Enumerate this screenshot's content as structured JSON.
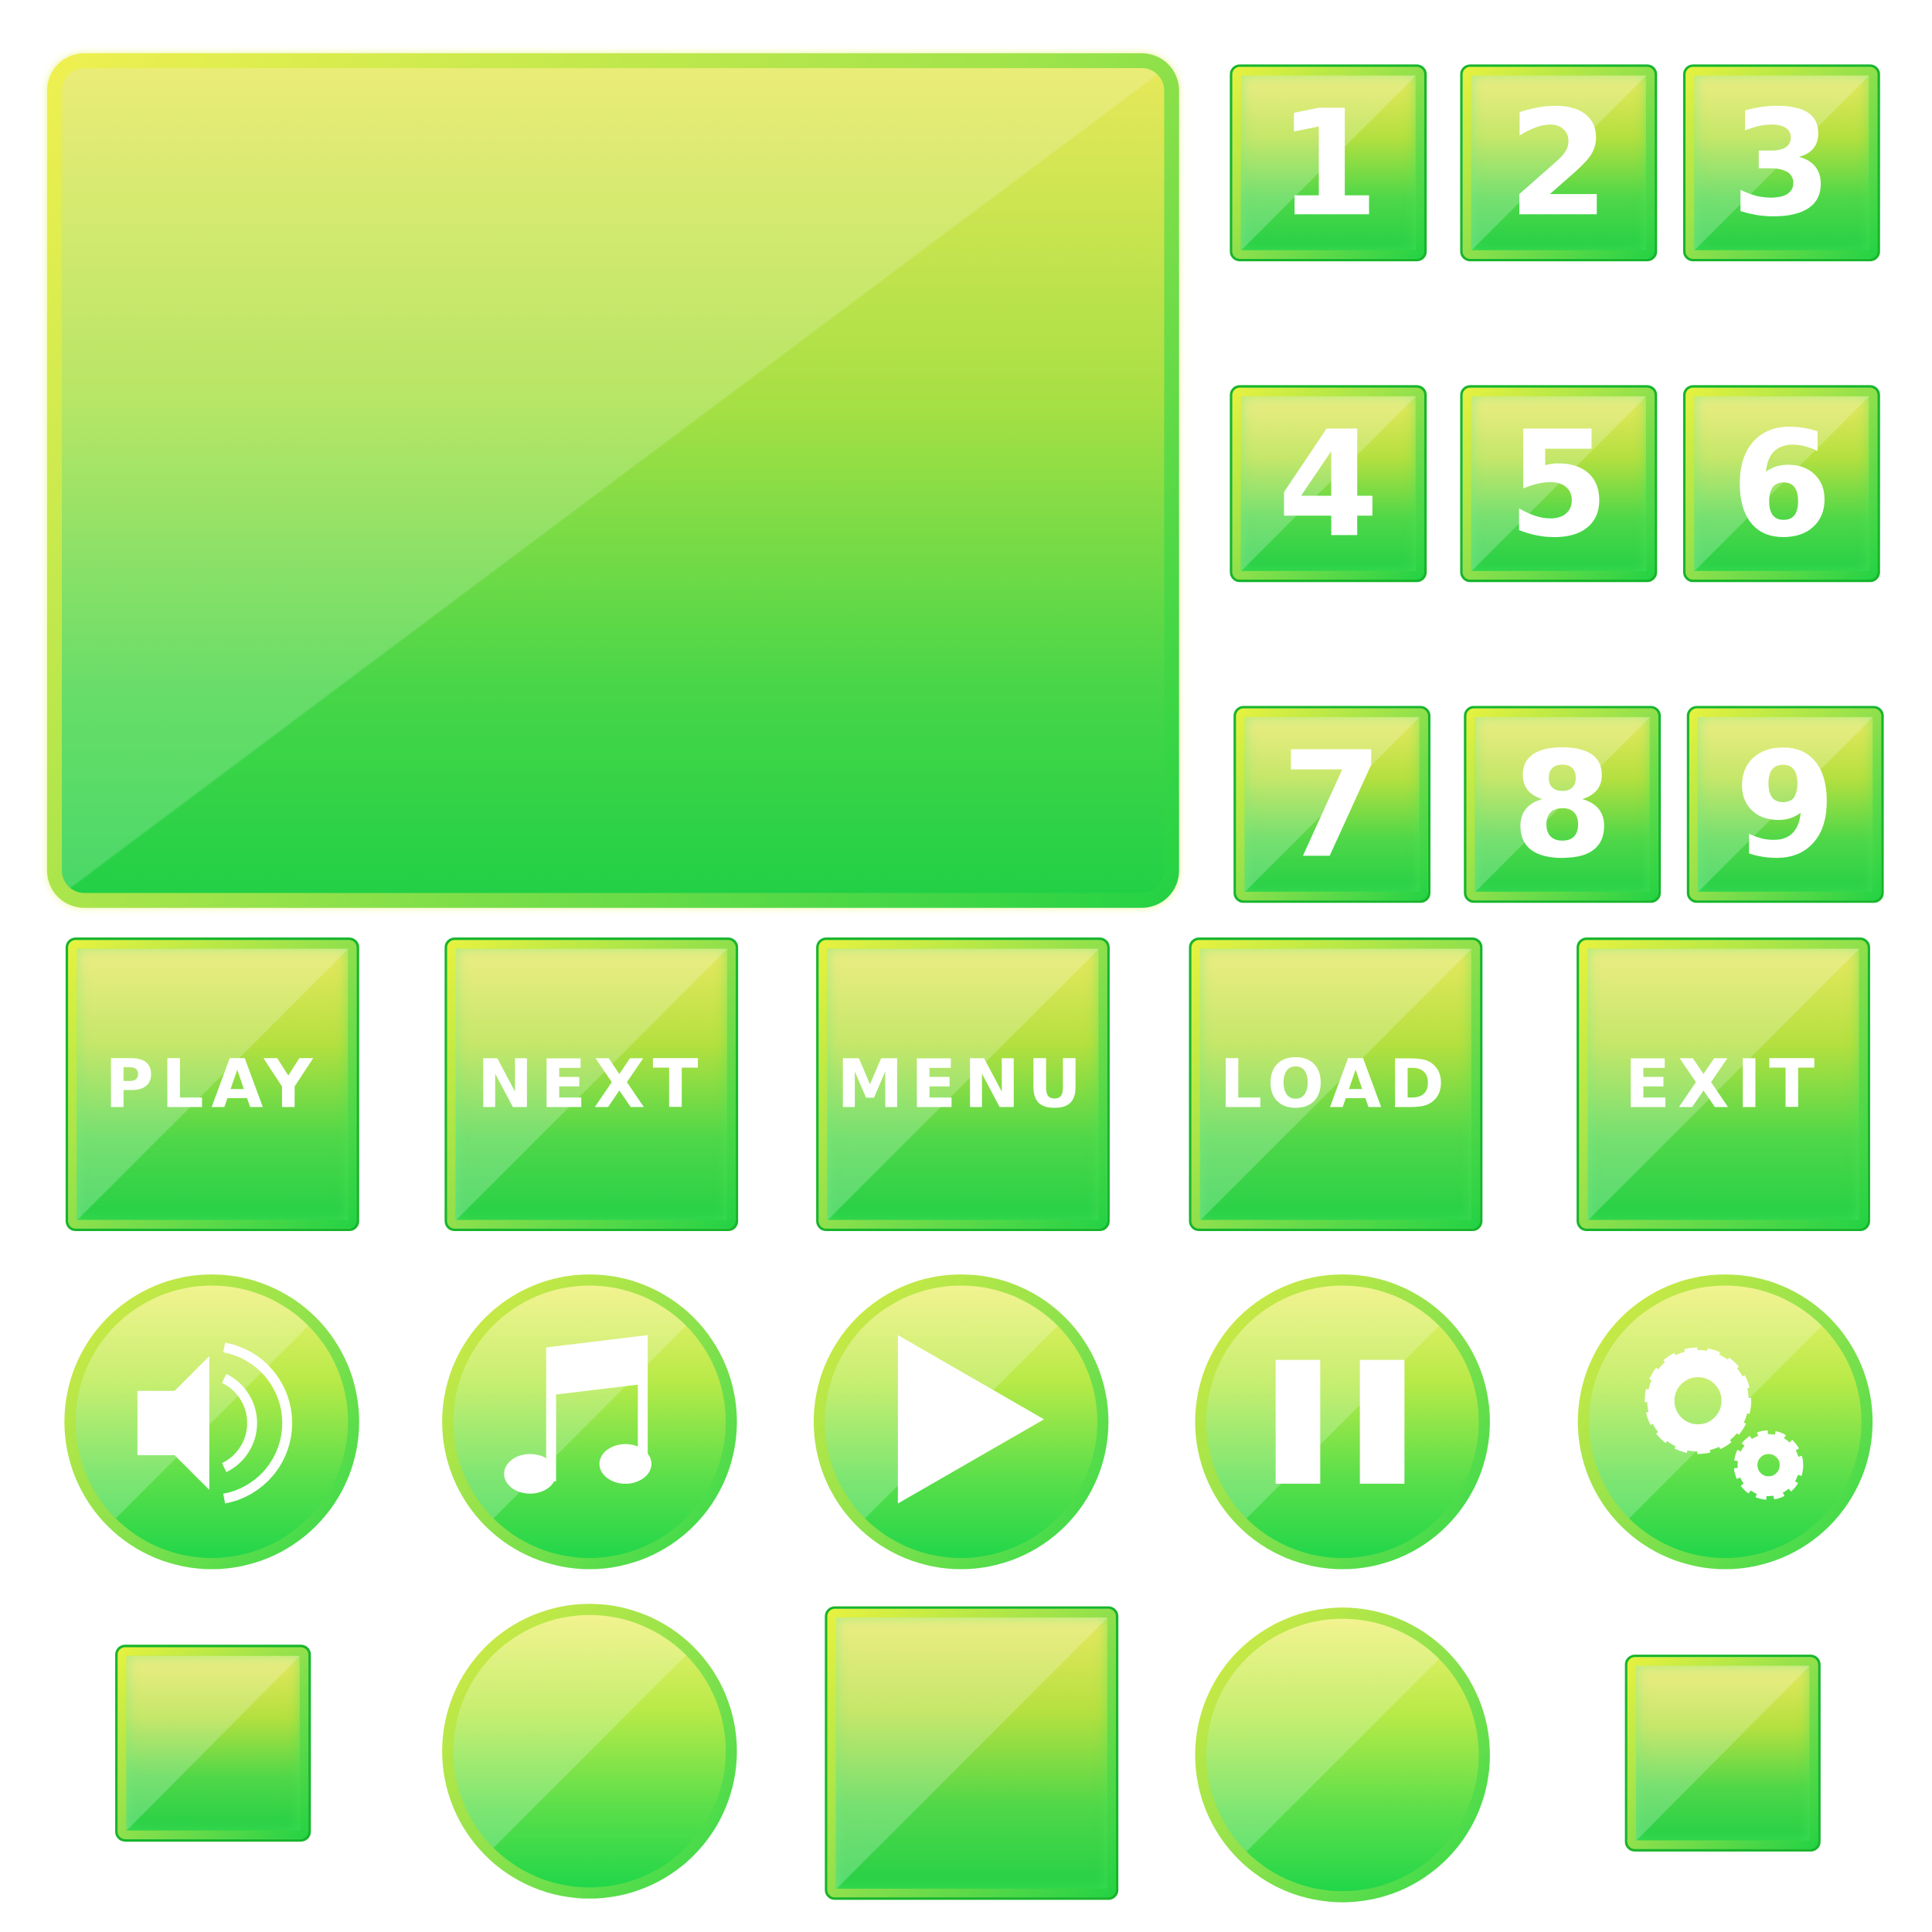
{
  "numbers": [
    "1",
    "2",
    "3",
    "4",
    "5",
    "6",
    "7",
    "8",
    "9"
  ],
  "labels": {
    "play": "PLAY",
    "next": "NEXT",
    "menu": "MENU",
    "load": "LOAD",
    "exit": "EXIT"
  },
  "icons": [
    "speaker-icon",
    "music-note-icon",
    "play-icon",
    "pause-icon",
    "gears-icon"
  ],
  "colors": {
    "top": "#e8f23f",
    "bottom": "#22d244",
    "border": "#17b52a"
  }
}
